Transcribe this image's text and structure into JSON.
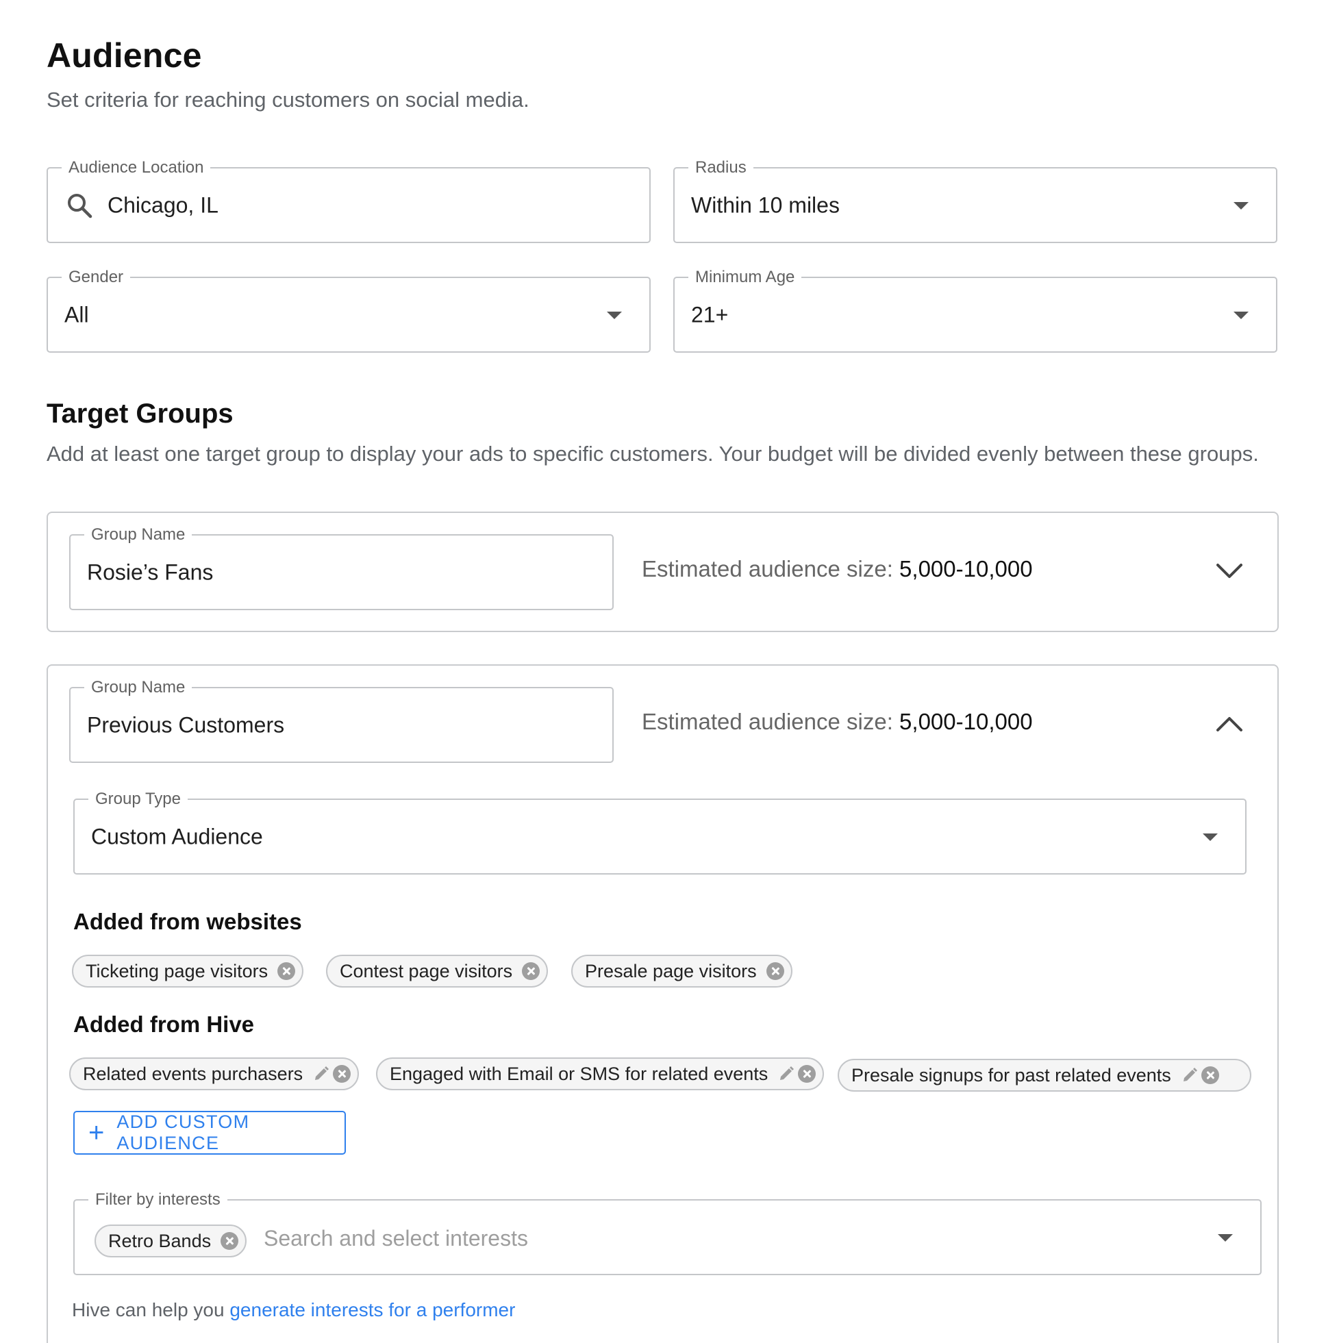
{
  "audience": {
    "title": "Audience",
    "subtitle": "Set criteria for reaching customers on social media.",
    "location": {
      "label": "Audience Location",
      "value": "Chicago, IL"
    },
    "radius": {
      "label": "Radius",
      "value": "Within 10 miles"
    },
    "gender": {
      "label": "Gender",
      "value": "All"
    },
    "min_age": {
      "label": "Minimum Age",
      "value": "21+"
    }
  },
  "target_groups": {
    "title": "Target Groups",
    "subtitle": "Add at least one target group to display your ads to specific customers. Your budget will be divided evenly between these groups.",
    "groups": [
      {
        "name_label": "Group Name",
        "name": "Rosie’s Fans",
        "est_label": "Estimated audience size:",
        "est_value": "5,000-10,000"
      },
      {
        "name_label": "Group Name",
        "name": "Previous Customers",
        "est_label": "Estimated audience size:",
        "est_value": "5,000-10,000",
        "type_label": "Group Type",
        "type_value": "Custom Audience",
        "websites_heading": "Added from websites",
        "website_chips": [
          "Ticketing page visitors",
          "Contest page visitors",
          "Presale page visitors"
        ],
        "hive_heading": "Added from Hive",
        "hive_chips": [
          "Related events purchasers",
          "Engaged with Email or SMS for related events",
          "Presale signups for past related events"
        ],
        "add_button": "ADD CUSTOM AUDIENCE",
        "interests_label": "Filter by interests",
        "interest_chips": [
          "Retro Bands"
        ],
        "interests_placeholder": "Search and select interests",
        "hint_prefix": "Hive can help you ",
        "hint_link": "generate interests for a performer"
      }
    ]
  },
  "icons": {
    "search": "search-icon",
    "dropdown": "arrow-drop-down-icon",
    "expand": "chevron-down-icon",
    "collapse": "chevron-up-icon",
    "remove": "remove-circle-icon",
    "edit": "pencil-icon",
    "add": "plus-icon"
  },
  "colors": {
    "accent": "#2f80ed",
    "border": "#c4c6c9",
    "muted_text": "#5f6368"
  }
}
